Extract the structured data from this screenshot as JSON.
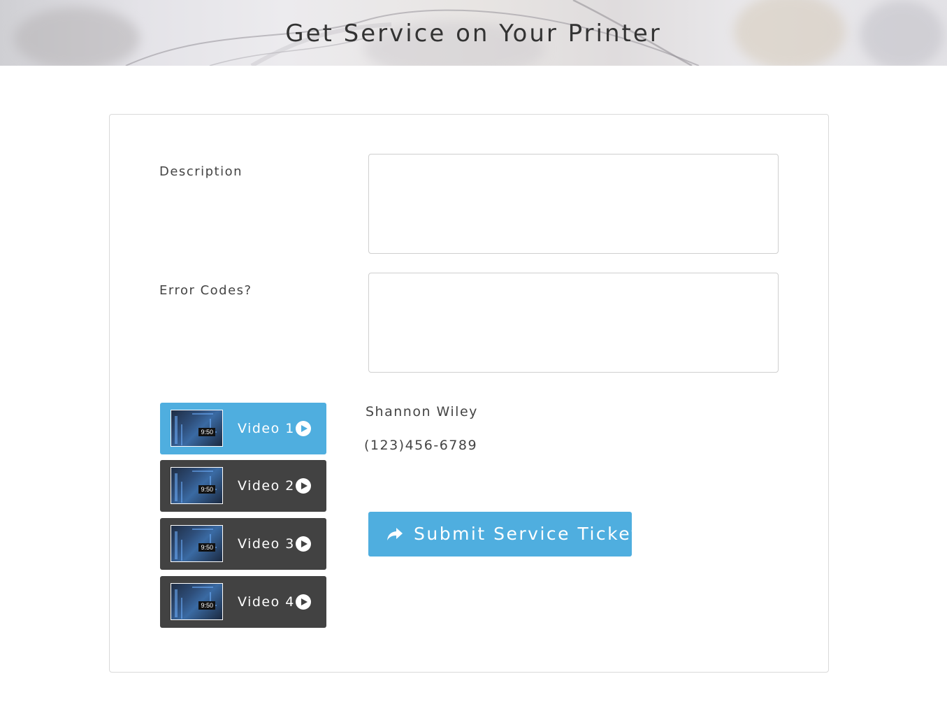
{
  "header": {
    "title": "Get Service on Your Printer"
  },
  "form": {
    "description_label": "Description",
    "description_value": "",
    "error_codes_label": "Error Codes?",
    "error_codes_value": ""
  },
  "videos": [
    {
      "label": "Video 1",
      "duration": "9:50",
      "active": true
    },
    {
      "label": "Video 2",
      "duration": "9:50",
      "active": false
    },
    {
      "label": "Video 3",
      "duration": "9:50",
      "active": false
    },
    {
      "label": "Video 4",
      "duration": "9:50",
      "active": false
    }
  ],
  "contact": {
    "name": "Shannon Wiley",
    "phone": "(123)456-6789"
  },
  "submit": {
    "label": "Submit Service Ticket",
    "icon": "share-icon"
  },
  "colors": {
    "accent": "#4faedf",
    "dark_button": "#424242",
    "border": "#d9d9d9"
  }
}
